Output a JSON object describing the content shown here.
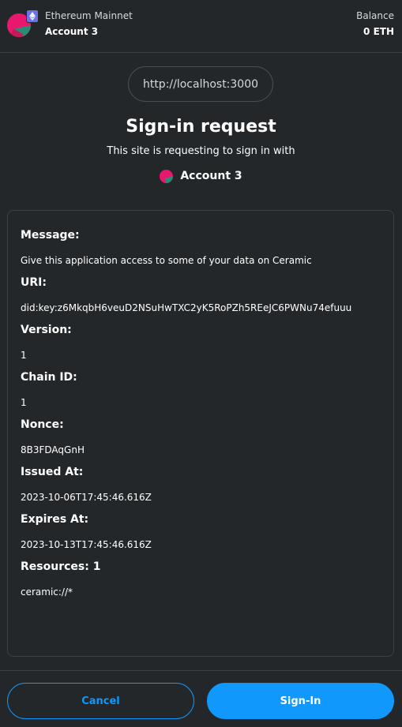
{
  "header": {
    "network": "Ethereum Mainnet",
    "account": "Account 3",
    "balance_label": "Balance",
    "balance_value": "0 ETH",
    "avatar_icon": "jazzicon-avatar",
    "network_icon": "ethereum-icon"
  },
  "origin": "http://localhost:3000",
  "title": "Sign-in request",
  "subtitle": "This site is requesting to sign in with",
  "signer": {
    "account": "Account 3",
    "avatar_icon": "jazzicon-avatar"
  },
  "message_fields": [
    {
      "label": "Message:",
      "value": "Give this application access to some of your data on Ceramic"
    },
    {
      "label": "URI:",
      "value": "did:key:z6MkqbH6veuD2NSuHwTXC2yK5RoPZh5REeJC6PWNu74efuuu"
    },
    {
      "label": "Version:",
      "value": "1"
    },
    {
      "label": "Chain ID:",
      "value": "1"
    },
    {
      "label": "Nonce:",
      "value": "8B3FDAqGnH"
    },
    {
      "label": "Issued At:",
      "value": "2023-10-06T17:45:46.616Z"
    },
    {
      "label": "Expires At:",
      "value": "2023-10-13T17:45:46.616Z"
    },
    {
      "label": "Resources: 1",
      "value": "ceramic://*"
    }
  ],
  "buttons": {
    "cancel": "Cancel",
    "sign_in": "Sign-In"
  },
  "colors": {
    "background": "#24272a",
    "accent": "#1098fc",
    "border": "#3b4046"
  }
}
